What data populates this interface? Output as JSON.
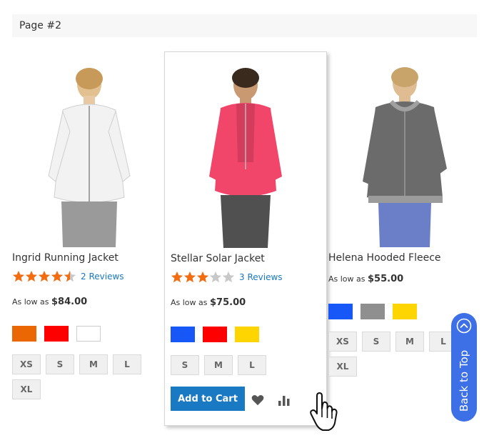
{
  "page_label": "Page #2",
  "products": [
    {
      "name": "Ingrid Running Jacket",
      "rating_stars": 4.5,
      "reviews": "2 Reviews",
      "price_prefix": "As low as",
      "price": "$84.00",
      "jacket_color": "#f2f2f2",
      "swatches": [
        "#eb6703",
        "#ff0000",
        "#ffffff"
      ],
      "sizes": [
        "XS",
        "S",
        "M",
        "L",
        "XL"
      ]
    },
    {
      "name": "Stellar Solar Jacket",
      "rating_stars": 3,
      "reviews": "3 Reviews",
      "price_prefix": "As low as",
      "price": "$75.00",
      "jacket_color": "#f2456a",
      "swatches": [
        "#1857f7",
        "#ff0000",
        "#ffd500"
      ],
      "sizes": [
        "S",
        "M",
        "L"
      ],
      "add_to_cart": "Add to Cart"
    },
    {
      "name": "Helena Hooded Fleece",
      "price_prefix": "As low as",
      "price": "$55.00",
      "jacket_color": "#6b6b6b",
      "swatches": [
        "#1857f7",
        "#8f8f8f",
        "#ffd500"
      ],
      "sizes": [
        "XS",
        "S",
        "M",
        "L",
        "XL"
      ]
    }
  ],
  "back_to_top": "Back to Top",
  "colors": {
    "link": "#1979c3",
    "star": "#f26c11",
    "star_empty": "#c8c8c8",
    "button": "#1979c3",
    "back_to_top": "#3d6fe6"
  },
  "icons": {
    "wishlist": "heart-icon",
    "compare": "bar-chart-icon",
    "cursor": "hand-cursor-icon",
    "back_to_top": "chevron-up-circle-icon"
  }
}
